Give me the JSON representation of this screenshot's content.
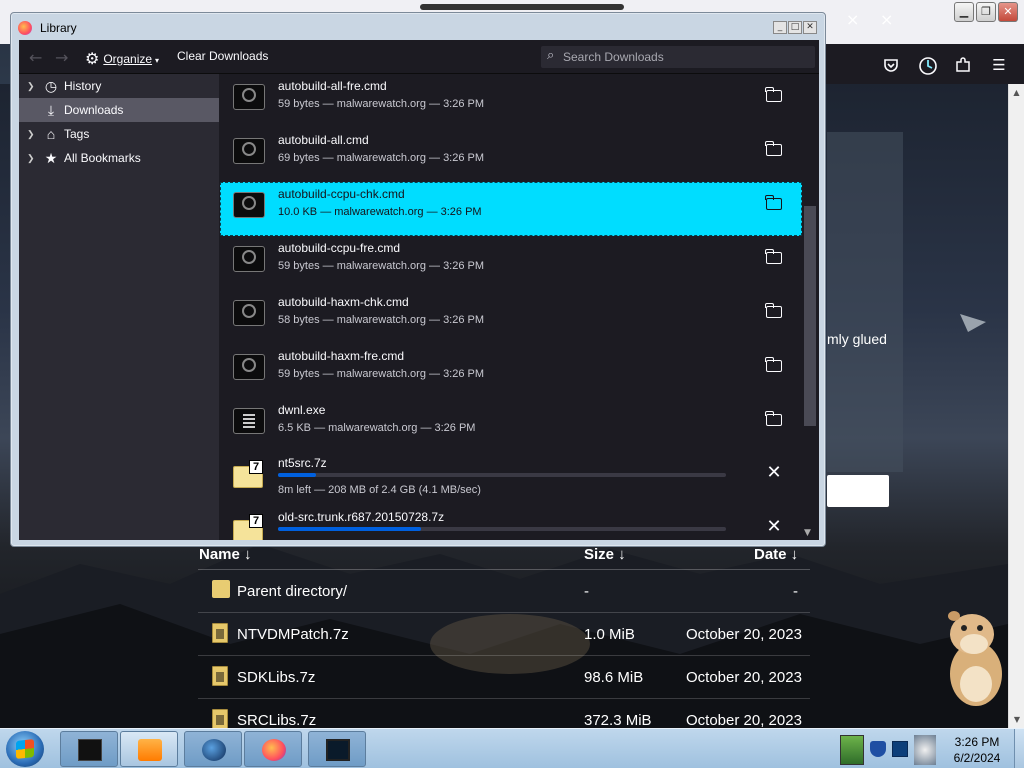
{
  "library": {
    "title": "Library",
    "toolbar": {
      "organize_label": "Organize",
      "clear_downloads_label": "Clear Downloads",
      "search_placeholder": "Search Downloads"
    },
    "sidebar": [
      {
        "label": "History",
        "icon": "clock-icon",
        "expandable": true,
        "selected": false
      },
      {
        "label": "Downloads",
        "icon": "download-icon",
        "expandable": false,
        "selected": true
      },
      {
        "label": "Tags",
        "icon": "tag-icon",
        "expandable": true,
        "selected": false
      },
      {
        "label": "All Bookmarks",
        "icon": "star-icon",
        "expandable": true,
        "selected": false
      }
    ],
    "downloads": [
      {
        "name": "autobuild-all-fre.cmd",
        "status": "59 bytes — malwarewatch.org — 3:26 PM",
        "kind": "cmd",
        "state": "done"
      },
      {
        "name": "autobuild-all.cmd",
        "status": "69 bytes — malwarewatch.org — 3:26 PM",
        "kind": "cmd",
        "state": "done"
      },
      {
        "name": "autobuild-ccpu-chk.cmd",
        "status": "10.0 KB — malwarewatch.org — 3:26 PM",
        "kind": "cmd",
        "state": "done",
        "selected": true
      },
      {
        "name": "autobuild-ccpu-fre.cmd",
        "status": "59 bytes — malwarewatch.org — 3:26 PM",
        "kind": "cmd",
        "state": "done"
      },
      {
        "name": "autobuild-haxm-chk.cmd",
        "status": "58 bytes — malwarewatch.org — 3:26 PM",
        "kind": "cmd",
        "state": "done"
      },
      {
        "name": "autobuild-haxm-fre.cmd",
        "status": "59 bytes — malwarewatch.org — 3:26 PM",
        "kind": "cmd",
        "state": "done"
      },
      {
        "name": "dwnl.exe",
        "status": "6.5 KB — malwarewatch.org — 3:26 PM",
        "kind": "exe",
        "state": "done"
      },
      {
        "name": "nt5src.7z",
        "status": "8m left — 208 MB of 2.4 GB (4.1 MB/sec)",
        "kind": "7z",
        "state": "downloading",
        "progress": 0.085
      },
      {
        "name": "old-src.trunk.r687.20150728.7z",
        "status": "",
        "kind": "7z",
        "state": "downloading",
        "progress": 0.32
      }
    ]
  },
  "background_page": {
    "partial_text": "mly glued",
    "listing": {
      "headers": {
        "name": "Name ↓",
        "size": "Size ↓",
        "date": "Date ↓"
      },
      "rows": [
        {
          "name": "Parent directory/",
          "size": "-",
          "date": "-",
          "kind": "parent"
        },
        {
          "name": "NTVDMPatch.7z",
          "size": "1.0 MiB",
          "date": "October 20, 2023",
          "kind": "7z"
        },
        {
          "name": "SDKLibs.7z",
          "size": "98.6 MiB",
          "date": "October 20, 2023",
          "kind": "7z"
        },
        {
          "name": "SRCLibs.7z",
          "size": "372.3 MiB",
          "date": "October 20, 2023",
          "kind": "7z"
        }
      ]
    }
  },
  "taskbar": {
    "clock_time": "3:26 PM",
    "clock_date": "6/2/2024",
    "apps": [
      "cmd-window",
      "media-player",
      "globe",
      "firefox",
      "monitor"
    ]
  },
  "colors": {
    "selection": "#00ddff",
    "progress": "#0060df",
    "dark_bg": "#1c1b22",
    "sidebar_bg": "#2b2a33"
  }
}
